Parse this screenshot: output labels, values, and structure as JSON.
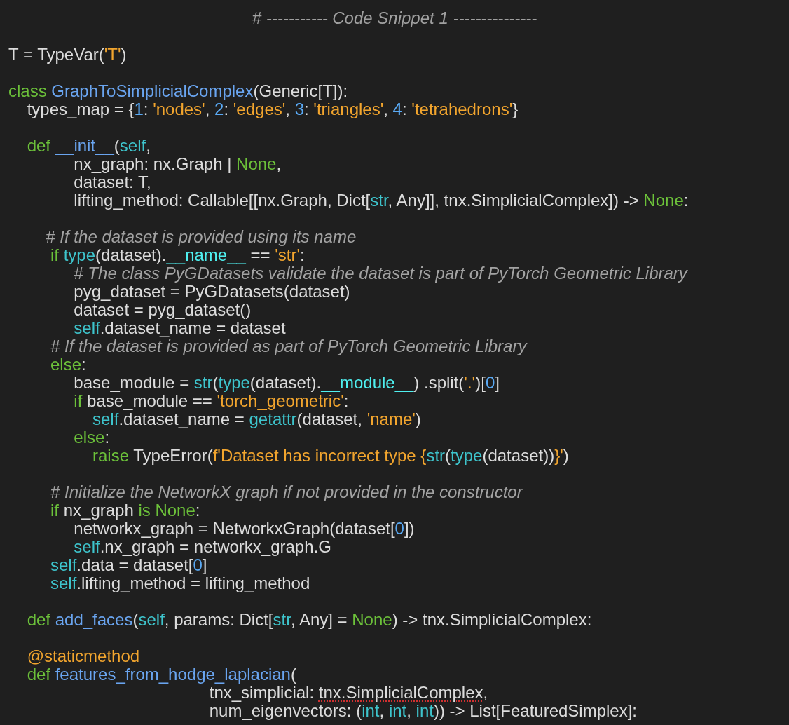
{
  "title": "# ----------- Code Snippet 1 ---------------",
  "blocks": [
    {
      "lines": [
        [
          {
            "kind": "plain",
            "text": "T = TypeVar("
          },
          {
            "kind": "string",
            "text": "'T'"
          },
          {
            "kind": "plain",
            "text": ")"
          }
        ]
      ]
    },
    {
      "lines": [
        [
          {
            "kind": "keyword",
            "text": "class "
          },
          {
            "kind": "function",
            "text": "GraphToSimplicialComplex"
          },
          {
            "kind": "plain",
            "text": "(Generic[T]):"
          }
        ],
        [
          {
            "kind": "plain",
            "text": "    types_map = {"
          },
          {
            "kind": "number",
            "text": "1"
          },
          {
            "kind": "plain",
            "text": ": "
          },
          {
            "kind": "string",
            "text": "'nodes'"
          },
          {
            "kind": "plain",
            "text": ", "
          },
          {
            "kind": "number",
            "text": "2"
          },
          {
            "kind": "plain",
            "text": ": "
          },
          {
            "kind": "string",
            "text": "'edges'"
          },
          {
            "kind": "plain",
            "text": ", "
          },
          {
            "kind": "number",
            "text": "3"
          },
          {
            "kind": "plain",
            "text": ": "
          },
          {
            "kind": "string",
            "text": "'triangles'"
          },
          {
            "kind": "plain",
            "text": ", "
          },
          {
            "kind": "number",
            "text": "4"
          },
          {
            "kind": "plain",
            "text": ": "
          },
          {
            "kind": "string",
            "text": "'tetrahedrons'"
          },
          {
            "kind": "plain",
            "text": "}"
          }
        ]
      ]
    },
    {
      "lines": [
        [
          {
            "kind": "keyword",
            "text": "    def "
          },
          {
            "kind": "function",
            "text": "__init__"
          },
          {
            "kind": "plain",
            "text": "("
          },
          {
            "kind": "builtin",
            "text": "self"
          },
          {
            "kind": "plain",
            "text": ","
          }
        ],
        [
          {
            "kind": "plain",
            "text": "              nx_graph: nx.Graph | "
          },
          {
            "kind": "keyword",
            "text": "None"
          },
          {
            "kind": "plain",
            "text": ","
          }
        ],
        [
          {
            "kind": "plain",
            "text": "              dataset: T,"
          }
        ],
        [
          {
            "kind": "plain",
            "text": "              lifting_method: Callable[[nx.Graph, Dict["
          },
          {
            "kind": "builtin",
            "text": "str"
          },
          {
            "kind": "plain",
            "text": ", Any]], tnx.SimplicialComplex]) -> "
          },
          {
            "kind": "keyword",
            "text": "None"
          },
          {
            "kind": "plain",
            "text": ":"
          }
        ]
      ]
    },
    {
      "lines": [
        [
          {
            "kind": "comment",
            "text": "        # If the dataset is provided using its name"
          }
        ],
        [
          {
            "kind": "keyword",
            "text": "         if "
          },
          {
            "kind": "builtin",
            "text": "type"
          },
          {
            "kind": "plain",
            "text": "(dataset)."
          },
          {
            "kind": "dunder",
            "text": "__name__"
          },
          {
            "kind": "plain",
            "text": " == "
          },
          {
            "kind": "string",
            "text": "'str'"
          },
          {
            "kind": "plain",
            "text": ":"
          }
        ],
        [
          {
            "kind": "comment",
            "text": "              # The class PyGDatasets validate the dataset is part of PyTorch Geometric Library"
          }
        ],
        [
          {
            "kind": "plain",
            "text": "              pyg_dataset = PyGDatasets(dataset)"
          }
        ],
        [
          {
            "kind": "plain",
            "text": "              dataset = pyg_dataset()"
          }
        ],
        [
          {
            "kind": "builtin",
            "text": "              self"
          },
          {
            "kind": "plain",
            "text": ".dataset_name = dataset"
          }
        ],
        [
          {
            "kind": "comment",
            "text": "         # If the dataset is provided as part of PyTorch Geometric Library"
          }
        ],
        [
          {
            "kind": "keyword",
            "text": "         else"
          },
          {
            "kind": "plain",
            "text": ":"
          }
        ],
        [
          {
            "kind": "plain",
            "text": "              base_module = "
          },
          {
            "kind": "builtin",
            "text": "str"
          },
          {
            "kind": "plain",
            "text": "("
          },
          {
            "kind": "builtin",
            "text": "type"
          },
          {
            "kind": "plain",
            "text": "(dataset)."
          },
          {
            "kind": "dunder",
            "text": "__module__"
          },
          {
            "kind": "plain",
            "text": ") .split("
          },
          {
            "kind": "string",
            "text": "'.'"
          },
          {
            "kind": "plain",
            "text": ")["
          },
          {
            "kind": "number",
            "text": "0"
          },
          {
            "kind": "plain",
            "text": "]"
          }
        ],
        [
          {
            "kind": "keyword",
            "text": "              if "
          },
          {
            "kind": "plain",
            "text": "base_module == "
          },
          {
            "kind": "string",
            "text": "'torch_geometric'"
          },
          {
            "kind": "plain",
            "text": ":"
          }
        ],
        [
          {
            "kind": "builtin",
            "text": "                  self"
          },
          {
            "kind": "plain",
            "text": ".dataset_name = "
          },
          {
            "kind": "builtin",
            "text": "getattr"
          },
          {
            "kind": "plain",
            "text": "(dataset, "
          },
          {
            "kind": "string",
            "text": "'name'"
          },
          {
            "kind": "plain",
            "text": ")"
          }
        ],
        [
          {
            "kind": "keyword",
            "text": "              else"
          },
          {
            "kind": "plain",
            "text": ":"
          }
        ],
        [
          {
            "kind": "keyword",
            "text": "                  raise "
          },
          {
            "kind": "plain",
            "text": "TypeError("
          },
          {
            "kind": "string",
            "text": "f'Dataset has incorrect type {"
          },
          {
            "kind": "builtin",
            "text": "str"
          },
          {
            "kind": "plain",
            "text": "("
          },
          {
            "kind": "builtin",
            "text": "type"
          },
          {
            "kind": "plain",
            "text": "(dataset))"
          },
          {
            "kind": "string",
            "text": "}'"
          },
          {
            "kind": "plain",
            "text": ")"
          }
        ]
      ]
    },
    {
      "lines": [
        [
          {
            "kind": "comment",
            "text": "         # Initialize the NetworkX graph if not provided in the constructor"
          }
        ],
        [
          {
            "kind": "keyword",
            "text": "         if "
          },
          {
            "kind": "plain",
            "text": "nx_graph "
          },
          {
            "kind": "keyword",
            "text": "is None"
          },
          {
            "kind": "plain",
            "text": ":"
          }
        ],
        [
          {
            "kind": "plain",
            "text": "              networkx_graph = NetworkxGraph(dataset["
          },
          {
            "kind": "number",
            "text": "0"
          },
          {
            "kind": "plain",
            "text": "])"
          }
        ],
        [
          {
            "kind": "builtin",
            "text": "              self"
          },
          {
            "kind": "plain",
            "text": ".nx_graph = networkx_graph.G"
          }
        ],
        [
          {
            "kind": "builtin",
            "text": "         self"
          },
          {
            "kind": "plain",
            "text": ".data = dataset["
          },
          {
            "kind": "number",
            "text": "0"
          },
          {
            "kind": "plain",
            "text": "]"
          }
        ],
        [
          {
            "kind": "builtin",
            "text": "         self"
          },
          {
            "kind": "plain",
            "text": ".lifting_method = lifting_method"
          }
        ]
      ]
    },
    {
      "lines": [
        [
          {
            "kind": "keyword",
            "text": "    def "
          },
          {
            "kind": "function",
            "text": "add_faces"
          },
          {
            "kind": "plain",
            "text": "("
          },
          {
            "kind": "builtin",
            "text": "self"
          },
          {
            "kind": "plain",
            "text": ", params: Dict["
          },
          {
            "kind": "builtin",
            "text": "str"
          },
          {
            "kind": "plain",
            "text": ", Any] = "
          },
          {
            "kind": "keyword",
            "text": "None"
          },
          {
            "kind": "plain",
            "text": ") -> tnx.SimplicialComplex:"
          }
        ]
      ]
    },
    {
      "lines": [
        [
          {
            "kind": "decorator",
            "text": "    @staticmethod"
          }
        ],
        [
          {
            "kind": "keyword",
            "text": "    def "
          },
          {
            "kind": "function",
            "text": "features_from_hodge_laplacian"
          },
          {
            "kind": "plain",
            "text": "("
          }
        ],
        [
          {
            "kind": "plain",
            "text": "                                           tnx_simplicial: "
          },
          {
            "kind": "error",
            "text": "tnx.SimplicialComplex"
          },
          {
            "kind": "plain",
            "text": ","
          }
        ],
        [
          {
            "kind": "plain",
            "text": "                                           num_eigenvectors: ("
          },
          {
            "kind": "builtin",
            "text": "int"
          },
          {
            "kind": "plain",
            "text": ", "
          },
          {
            "kind": "builtin",
            "text": "int"
          },
          {
            "kind": "plain",
            "text": ", "
          },
          {
            "kind": "builtin",
            "text": "int"
          },
          {
            "kind": "plain",
            "text": ")) -> List[FeaturedSimplex]:"
          }
        ]
      ]
    }
  ]
}
